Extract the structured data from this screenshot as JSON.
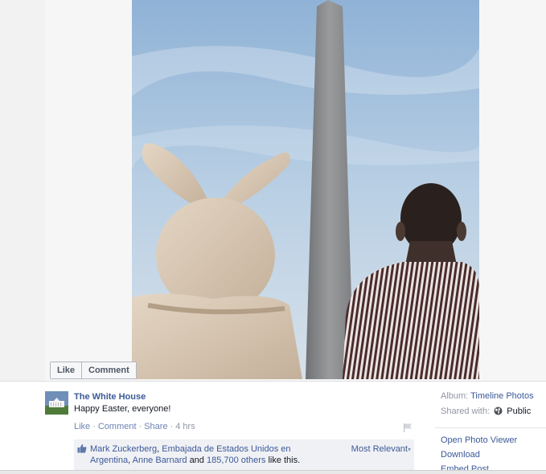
{
  "photo_actions": {
    "like": "Like",
    "comment": "Comment"
  },
  "post": {
    "page_name": "The White House",
    "caption": "Happy Easter, everyone!",
    "actions": {
      "like": "Like",
      "comment": "Comment",
      "share": "Share",
      "separator": "·",
      "time": "4 hrs"
    }
  },
  "likes": {
    "liker_1": "Mark Zuckerberg",
    "liker_2": "Embajada de Estados Unidos en Argentina",
    "liker_3": "Anne Barnard",
    "and_1": "and",
    "count": "185,700 others",
    "suffix": "like this.",
    "sort_label": "Most Relevant",
    "sort_arrow": "▾"
  },
  "side": {
    "album_label": "Album:",
    "album_value": "Timeline Photos",
    "shared_label": "Shared with:",
    "shared_value": "Public",
    "open_viewer": "Open Photo Viewer",
    "download": "Download",
    "embed": "Embed Post"
  },
  "colors": {
    "link": "#3b5998",
    "sky": "#a9c4de",
    "monument": "#8c8d8f",
    "bunny": "#d8c7b3"
  },
  "icons": [
    "flag-icon",
    "thumbs-up-icon",
    "globe-icon"
  ]
}
